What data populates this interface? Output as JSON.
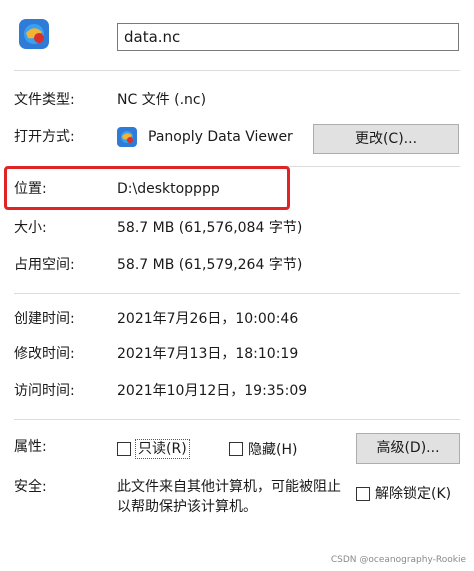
{
  "header": {
    "file_name": "data.nc",
    "icon": "panoply-globe-icon"
  },
  "general": {
    "type_label": "文件类型:",
    "type_value": "NC 文件 (.nc)",
    "open_with_label": "打开方式:",
    "open_with_icon": "panoply-app-icon",
    "open_with_value": "Panoply Data Viewer",
    "change_button": "更改(C)..."
  },
  "location": {
    "label": "位置:",
    "value": "D:\\desktopppp",
    "highlight_color": "#e02424"
  },
  "size": {
    "size_label": "大小:",
    "size_value": "58.7 MB (61,576,084 字节)",
    "disk_label": "占用空间:",
    "disk_value": "58.7 MB (61,579,264 字节)"
  },
  "times": {
    "created_label": "创建时间:",
    "created_value": "2021年7月26日，10:00:46",
    "modified_label": "修改时间:",
    "modified_value": "2021年7月13日，18:10:19",
    "accessed_label": "访问时间:",
    "accessed_value": "2021年10月12日，19:35:09"
  },
  "attributes": {
    "label": "属性:",
    "readonly": "只读(R)",
    "hidden": "隐藏(H)",
    "advanced_button": "高级(D)..."
  },
  "security": {
    "label": "安全:",
    "line1": "此文件来自其他计算机，可能被阻止",
    "line2": "以帮助保护该计算机。",
    "unblock": "解除锁定(K)"
  },
  "watermark": "CSDN @oceanography-Rookie"
}
